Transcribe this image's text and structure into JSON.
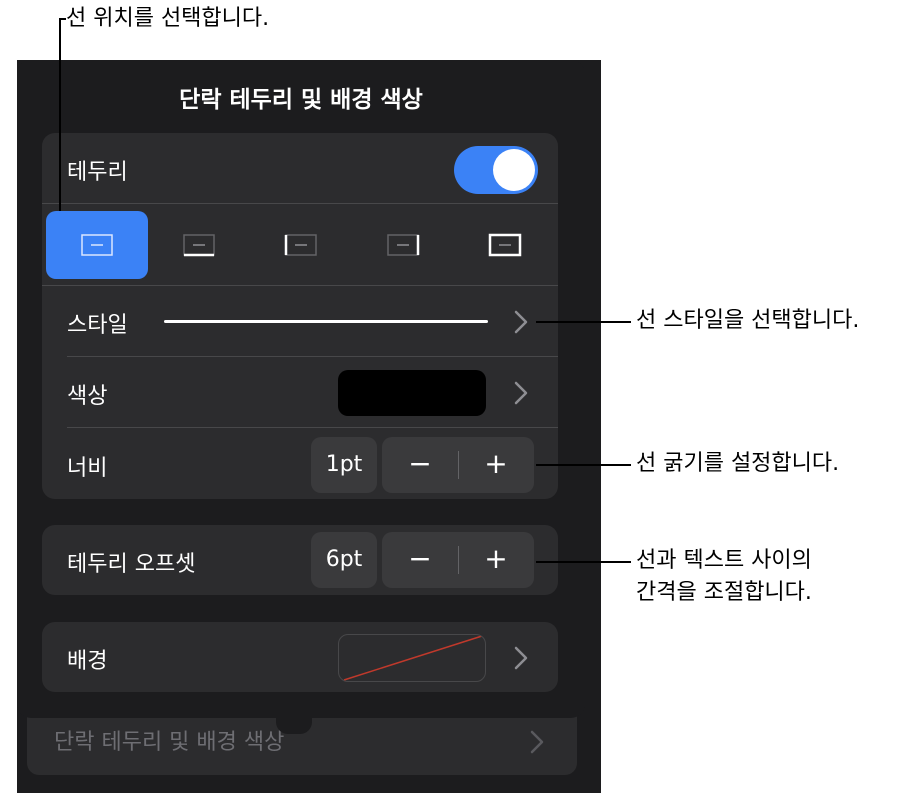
{
  "popover": {
    "title": "단락 테두리 및 배경 색상",
    "underlying_row_label": "단락 테두리 및 배경 색상"
  },
  "borders": {
    "toggle_label": "테두리",
    "toggle_on": true,
    "positions_selected_index": 0,
    "style_label": "스타일",
    "color_label": "색상",
    "color_value": "#000000",
    "width_label": "너비",
    "width_value": "1pt",
    "minus_symbol": "−",
    "plus_symbol": "+"
  },
  "offset": {
    "label": "테두리 오프셋",
    "value": "6pt"
  },
  "background": {
    "label": "배경"
  },
  "callouts": {
    "position": "선 위치를 선택합니다.",
    "style": "선 스타일을 선택합니다.",
    "thickness": "선 굵기를 설정합니다.",
    "spacing_line1": "선과 텍스트 사이의",
    "spacing_line2": "간격을 조절합니다."
  },
  "colors": {
    "accent": "#3b82f6",
    "panel": "#1c1c1e",
    "group": "#2c2c2e",
    "no_fill_slash": "#c0392b"
  },
  "icons": [
    "chevron-right-icon",
    "border-all-icon",
    "border-bottom-icon",
    "border-left-icon",
    "border-right-icon",
    "border-outline-icon",
    "minus-icon",
    "plus-icon"
  ]
}
